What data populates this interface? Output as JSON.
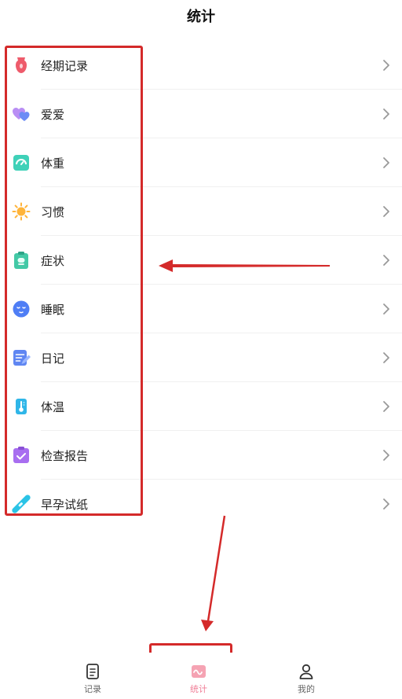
{
  "header": {
    "title": "统计"
  },
  "items": [
    {
      "label": "经期记录",
      "icon": "period-icon"
    },
    {
      "label": "爱爱",
      "icon": "hearts-icon"
    },
    {
      "label": "体重",
      "icon": "scale-icon"
    },
    {
      "label": "习惯",
      "icon": "sun-icon"
    },
    {
      "label": "症状",
      "icon": "symptom-clipboard-icon"
    },
    {
      "label": "睡眠",
      "icon": "sleep-face-icon"
    },
    {
      "label": "日记",
      "icon": "diary-pen-icon"
    },
    {
      "label": "体温",
      "icon": "thermometer-icon"
    },
    {
      "label": "检查报告",
      "icon": "check-report-icon"
    },
    {
      "label": "早孕试纸",
      "icon": "pregnancy-test-icon"
    }
  ],
  "tabbar": {
    "tabs": [
      {
        "label": "记录",
        "icon": "record-doc-icon",
        "active": false
      },
      {
        "label": "统计",
        "icon": "stats-wave-icon",
        "active": true
      },
      {
        "label": "我的",
        "icon": "profile-icon",
        "active": false
      }
    ]
  },
  "colors": {
    "annotation": "#d42a2a",
    "active_tab": "#f07d96"
  }
}
